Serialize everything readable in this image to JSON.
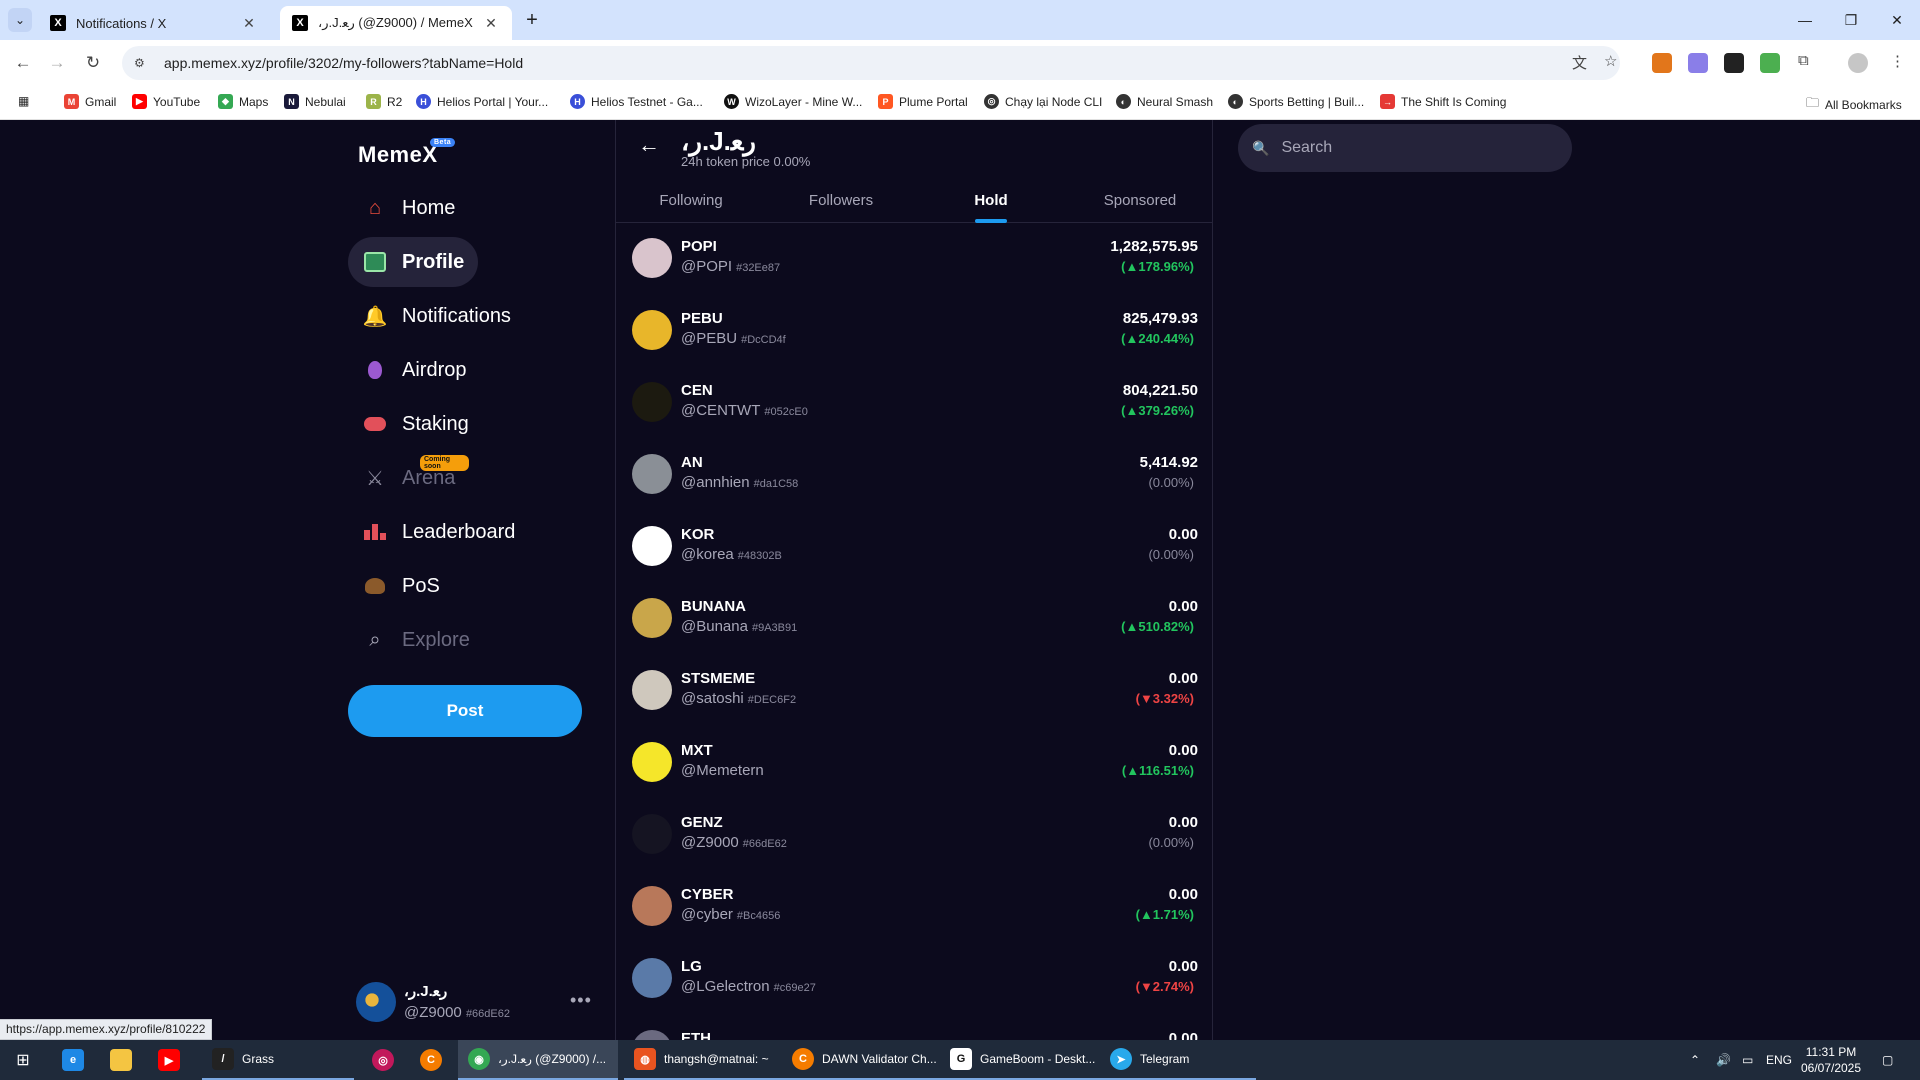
{
  "browser": {
    "tabs": [
      {
        "title": "Notifications / X",
        "active": false
      },
      {
        "title": "،ﺭ.J.ﺭﻌ (@Z9000) / MemeX",
        "active": true
      }
    ],
    "url": "app.memex.xyz/profile/3202/my-followers?tabName=Hold",
    "bookmarks": [
      "Gmail",
      "YouTube",
      "Maps",
      "Nebulai",
      "R2",
      "Helios Portal | Your...",
      "Helios Testnet - Ga...",
      "WizoLayer - Mine W...",
      "Plume Portal",
      "Chạy lại Node CLI",
      "Neural Smash",
      "Sports Betting | Buil...",
      "The Shift Is Coming"
    ],
    "all_bookmarks": "All Bookmarks",
    "status_url": "https://app.memex.xyz/profile/810222"
  },
  "app": {
    "logo": "MemeX",
    "logo_badge": "Beta",
    "nav": [
      {
        "label": "Home",
        "icon": "home-icon"
      },
      {
        "label": "Profile",
        "icon": "profile-icon"
      },
      {
        "label": "Notifications",
        "icon": "bell-icon"
      },
      {
        "label": "Airdrop",
        "icon": "balloon-icon"
      },
      {
        "label": "Staking",
        "icon": "staking-icon"
      },
      {
        "label": "Arena",
        "icon": "swords-icon"
      },
      {
        "label": "Leaderboard",
        "icon": "leaderboard-icon"
      },
      {
        "label": "PoS",
        "icon": "pos-icon"
      },
      {
        "label": "Explore",
        "icon": "search-icon"
      }
    ],
    "arena_badge": "Coming soon",
    "post_label": "Post",
    "me": {
      "name": "،ﺭ.J.ﺭﻌ",
      "handle": "@Z9000",
      "hash": "#66dE62",
      "more": "•••"
    },
    "search_placeholder": "Search"
  },
  "profile": {
    "name": "،ﺭ.J.ﺭﻌ",
    "sub": "24h token price 0.00%",
    "tabs": [
      "Following",
      "Followers",
      "Hold",
      "Sponsored"
    ],
    "active_tab": "Hold"
  },
  "holdings": [
    {
      "name": "POPI",
      "handle": "@POPI",
      "hash": "#32Ee87",
      "amount": "1,282,575.95",
      "change": "(▲178.96%)",
      "dir": "up",
      "color": "#d9c4cc"
    },
    {
      "name": "PEBU",
      "handle": "@PEBU",
      "hash": "#DcCD4f",
      "amount": "825,479.93",
      "change": "(▲240.44%)",
      "dir": "up",
      "color": "#e8b62a"
    },
    {
      "name": "CEN",
      "handle": "@CENTWT",
      "hash": "#052cE0",
      "amount": "804,221.50",
      "change": "(▲379.26%)",
      "dir": "up",
      "color": "#1c1a10"
    },
    {
      "name": "AN",
      "handle": "@annhien",
      "hash": "#da1C58",
      "amount": "5,414.92",
      "change": "(0.00%)",
      "dir": "flat",
      "color": "#8a8f96"
    },
    {
      "name": "KOR",
      "handle": "@korea",
      "hash": "#48302B",
      "amount": "0.00",
      "change": "(0.00%)",
      "dir": "flat",
      "color": "#ffffff"
    },
    {
      "name": "BUNANA",
      "handle": "@Bunana",
      "hash": "#9A3B91",
      "amount": "0.00",
      "change": "(▲510.82%)",
      "dir": "up",
      "color": "#c9a64a"
    },
    {
      "name": "STSMEME",
      "handle": "@satoshi",
      "hash": "#DEC6F2",
      "amount": "0.00",
      "change": "(▼3.32%)",
      "dir": "down",
      "color": "#cfc8bd"
    },
    {
      "name": "MXT",
      "handle": "@Memetern",
      "hash": "",
      "amount": "0.00",
      "change": "(▲116.51%)",
      "dir": "up",
      "color": "#f5e62a"
    },
    {
      "name": "GENZ",
      "handle": "@Z9000",
      "hash": "#66dE62",
      "amount": "0.00",
      "change": "(0.00%)",
      "dir": "flat",
      "color": "#151422"
    },
    {
      "name": "CYBER",
      "handle": "@cyber",
      "hash": "#Bc4656",
      "amount": "0.00",
      "change": "(▲1.71%)",
      "dir": "up",
      "color": "#b8785a"
    },
    {
      "name": "LG",
      "handle": "@LGelectron",
      "hash": "#c69e27",
      "amount": "0.00",
      "change": "(▼2.74%)",
      "dir": "down",
      "color": "#5a7aa8"
    },
    {
      "name": "ETH",
      "handle": "",
      "hash": "",
      "amount": "0.00",
      "change": "",
      "dir": "flat",
      "color": "#6b6a80"
    }
  ],
  "taskbar": {
    "items": [
      "Grass",
      "",
      "",
      "،ﺭ.J.ﺭﻌ (@Z9000) /...",
      "thangsh@matnai: ~",
      "DAWN Validator Ch...",
      "GameBoom - Deskt...",
      "Telegram"
    ],
    "lang": "ENG",
    "time": "11:31 PM",
    "date": "06/07/2025"
  }
}
